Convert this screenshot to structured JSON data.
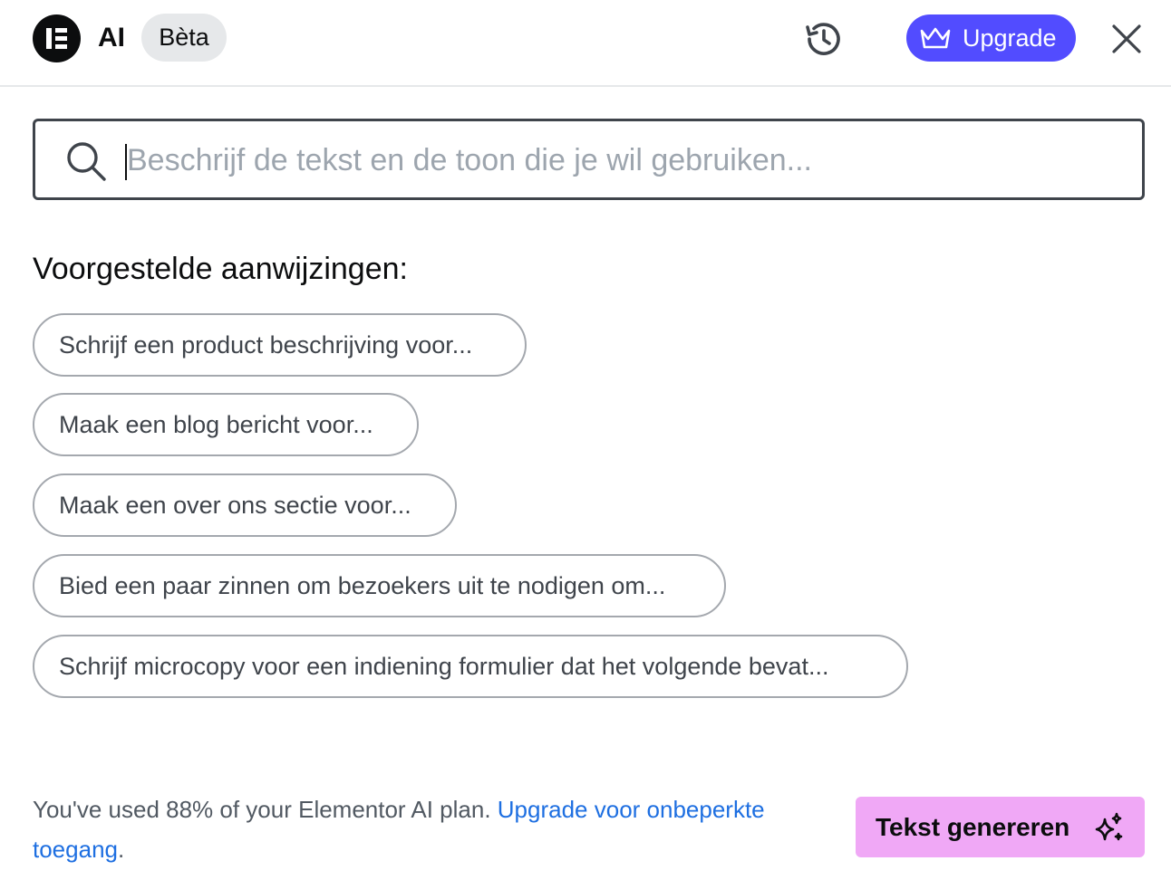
{
  "header": {
    "logo_icon": "elementor-logo-icon",
    "ai_label": "AI",
    "beta_badge": "Bèta",
    "history_icon": "history-icon",
    "upgrade_label": "Upgrade",
    "upgrade_icon": "crown-icon",
    "close_icon": "close-icon",
    "upgrade_color": "#524cff"
  },
  "search": {
    "placeholder": "Beschrijf de tekst en de toon die je wil gebruiken...",
    "value": "",
    "icon": "search-icon"
  },
  "suggestions": {
    "title": "Voorgestelde aanwijzingen:",
    "items": [
      "Schrijf een product beschrijving voor...",
      "Maak een blog bericht voor...",
      "Maak een over ons sectie voor...",
      "Bied een paar zinnen om bezoekers uit te nodigen om...",
      "Schrijf microcopy voor een indiening formulier dat het volgende bevat..."
    ]
  },
  "footer": {
    "usage_text": "You've used 88% of your Elementor AI plan. ",
    "usage_link": "Upgrade voor onbeperkte toegang",
    "usage_end": ".",
    "usage_percent": 88,
    "generate_label": "Tekst genereren",
    "generate_icon": "sparkle-icon",
    "generate_color": "#f0a8f6"
  }
}
